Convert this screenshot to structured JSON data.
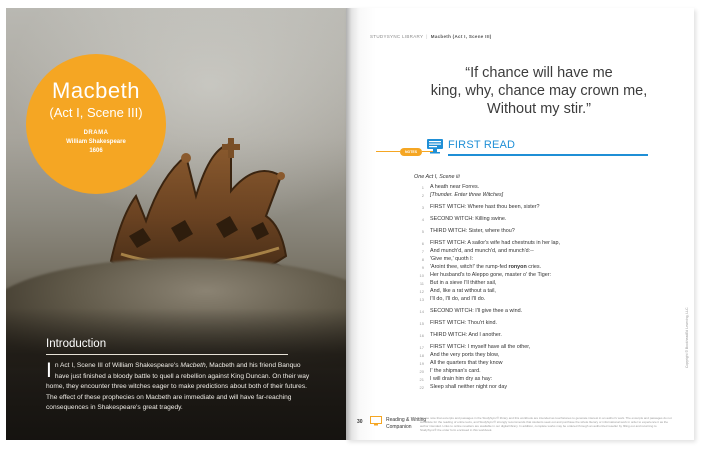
{
  "left_page": {
    "circle": {
      "title": "Macbeth",
      "subtitle": "(Act I, Scene III)",
      "genre": "DRAMA",
      "author": "William Shakespeare",
      "year": "1606"
    },
    "intro": {
      "heading": "Introduction",
      "dropcap": "I",
      "text_1": "n Act I, Scene III of William Shakespeare's ",
      "title_ital": "Macbeth",
      "text_2": ", Macbeth and his friend Banquo have just finished a bloody battle to quell a rebellion against King Duncan. On their way home, they encounter three witches eager to make predictions about both of their futures. The effect of these prophecies on Macbeth are immediate and will have far-reaching consequences in Shakespeare's great tragedy."
    }
  },
  "right_page": {
    "header": {
      "library": "STUDYSYNC LIBRARY",
      "separator": "|",
      "title": "Macbeth (Act I, Scene III)"
    },
    "quote": {
      "line1": "“If chance will have me",
      "line2": "king, why, chance may crown me,",
      "line3": "Without my stir.”"
    },
    "first_read": {
      "badge": "NOTES",
      "title": "FIRST READ"
    },
    "play_heading": "One Act I, Scene iii",
    "lines": [
      {
        "n": "1",
        "t": "A heath near Forres."
      },
      {
        "n": "2",
        "t": "[Thunder. Enter three Witches]",
        "ital": true
      },
      {
        "n": "3",
        "t": "FIRST WITCH: Where hast thou been, sister?"
      },
      {
        "n": "4",
        "t": "SECOND WITCH: Killing swine."
      },
      {
        "n": "5",
        "t": "THIRD WITCH: Sister, where thou?"
      },
      {
        "n": "6",
        "t": "FIRST WITCH: A sailor's wife had chestnuts in her lap,"
      },
      {
        "n": "7",
        "t": "And munch'd, and munch'd, and munch'd:--"
      },
      {
        "n": "8",
        "t": "'Give me,' quoth I:"
      },
      {
        "n": "9",
        "t_pre": "'Aroint thee, witch!' the rump-fed ",
        "t_bold": "ronyon",
        "t_post": " cries."
      },
      {
        "n": "10",
        "t": "Her husband's to Aleppo gone, master o' the Tiger:"
      },
      {
        "n": "11",
        "t": "But in a sieve I'll thither sail,"
      },
      {
        "n": "12",
        "t": "And, like a rat without a tail,"
      },
      {
        "n": "13",
        "t": "I'll do, I'll do, and I'll do."
      },
      {
        "n": "14",
        "t": "SECOND WITCH: I'll give thee a wind."
      },
      {
        "n": "15",
        "t": "FIRST WITCH: Thou'rt kind."
      },
      {
        "n": "16",
        "t": "THIRD WITCH: And I another."
      },
      {
        "n": "17",
        "t": "FIRST WITCH: I myself have all the other,"
      },
      {
        "n": "18",
        "t": "And the very ports they blow,"
      },
      {
        "n": "19",
        "t": "All the quarters that they know"
      },
      {
        "n": "20",
        "t": "I' the shipman's card."
      },
      {
        "n": "21",
        "t": "I will drain him dry as hay:"
      },
      {
        "n": "22",
        "t": "Sleep shall neither night nor day"
      }
    ],
    "footer": {
      "page_number": "30",
      "label_1": "Reading & Writing",
      "label_2": "Companion",
      "fine_print": "Please note that excerpts and passages in the StudySync® library and this workbook are intended as touchstones to generate interest in an author's work. The excerpts and passages do not substitute for the reading of entire texts, and StudySync® strongly recommends that students seek out and purchase the whole literary or informational work in order to experience it as the author intended. Links to online resellers are available in our digital library. In addition, complete works may be ordered through an authorized reseller by filling out and returning to StudySync® the order form enclosed in this workbook."
    },
    "copyright": "Copyright © BookheadEd Learning, LLC"
  },
  "colors": {
    "accent_orange": "#f5a623",
    "accent_blue": "#1f8fd6"
  }
}
